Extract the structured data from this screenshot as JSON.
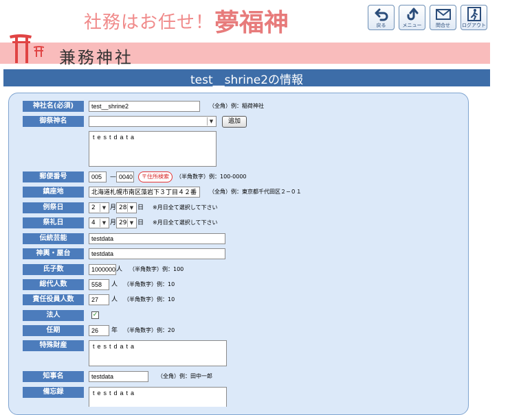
{
  "header": {
    "slogan": "社務はお任せ！",
    "brand": "夢福神",
    "nav": [
      {
        "icon": "back-arrow-icon",
        "label": "戻る"
      },
      {
        "icon": "menu-arrow-icon",
        "label": "メニュー"
      },
      {
        "icon": "envelope-icon",
        "label": "問合せ"
      },
      {
        "icon": "exit-icon",
        "label": "ログアウト"
      }
    ],
    "shrine_name": "兼務神社"
  },
  "page_title": "test__shrine2の情報",
  "form": {
    "shrine_name": {
      "label": "神社名(必須)",
      "value": "test__shrine2",
      "note": "（全角）例：稲荷神社"
    },
    "deity": {
      "label": "御祭神名",
      "value": "",
      "add_button": "追加",
      "text": "testdata"
    },
    "postal": {
      "label": "郵便番号",
      "part1": "005",
      "sep": "—",
      "part2": "0040",
      "search_button": "〒住所検索",
      "note": "（半角数字）例：100-0000"
    },
    "address": {
      "label": "鎮座地",
      "value": "北海道札幌市南区藻岩下３丁目４２番",
      "note": "（全角）例：東京都千代田区２−０１"
    },
    "regular_festival": {
      "label": "例祭日",
      "month": "2",
      "month_unit": "月",
      "day": "28",
      "day_unit": "日",
      "note": "※月日全て選択して下さい"
    },
    "festival": {
      "label": "祭礼日",
      "month": "4",
      "month_unit": "月",
      "day": "29",
      "day_unit": "日",
      "note": "※月日全て選択して下さい"
    },
    "traditional_arts": {
      "label": "伝統芸能",
      "value": "testdata"
    },
    "mikoshi": {
      "label": "神輿・屋台",
      "value": "testdata"
    },
    "parishioners": {
      "label": "氏子数",
      "value": "1000000",
      "unit": "人",
      "note": "（半角数字）例：100"
    },
    "representatives": {
      "label": "総代人数",
      "value": "558",
      "unit": "人",
      "note": "（半角数字）例：10"
    },
    "officers": {
      "label": "責任役員人数",
      "value": "27",
      "unit": "人",
      "note": "（半角数字）例：10"
    },
    "corporation": {
      "label": "法人",
      "checked": true,
      "mark": "✓"
    },
    "term": {
      "label": "任期",
      "value": "26",
      "unit": "年",
      "note": "（半角数字）例：20"
    },
    "special_property": {
      "label": "特殊財産",
      "text": "testdata"
    },
    "governor": {
      "label": "知事名",
      "value": "testdata",
      "note": "（全角）例：田中一郎"
    },
    "memo": {
      "label": "備忘録",
      "text": "testdata"
    }
  },
  "colors": {
    "accent": "#3d6da8",
    "label_bg": "#4c7cbc",
    "band": "#f9bcbc",
    "panel": "#dce9f9",
    "brand": "#e77b7b"
  }
}
